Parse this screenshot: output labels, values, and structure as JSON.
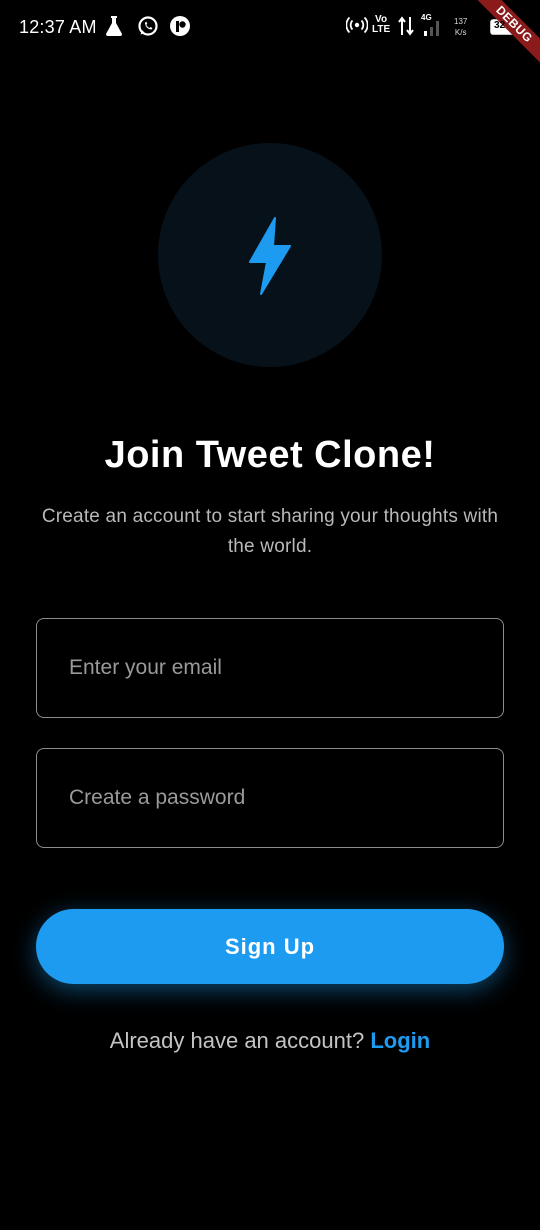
{
  "status_bar": {
    "time": "12:37 AM",
    "volte_top": "Vo",
    "volte_bottom": "LTE",
    "network": "4G",
    "speed_value": "137",
    "speed_unit": "K/s",
    "battery": "32",
    "icons": [
      "flask-icon",
      "whatsapp-icon",
      "app-icon",
      "hotspot-icon",
      "data-arrows-icon",
      "signal-icon",
      "battery-icon"
    ]
  },
  "debug_banner": "DEBUG",
  "logo": {
    "icon": "bolt-icon",
    "color": "#1d9bf0",
    "bg": "#06111a"
  },
  "title": "Join Tweet Clone!",
  "subtitle": "Create an account to start sharing your thoughts with the world.",
  "form": {
    "email_placeholder": "Enter your email",
    "email_value": "",
    "password_placeholder": "Create a password",
    "password_value": ""
  },
  "signup_label": "Sign Up",
  "login_prompt": "Already have an account?",
  "login_link": "Login",
  "colors": {
    "accent": "#1d9bf0",
    "background": "#000000",
    "debug": "#8b1a1a"
  }
}
